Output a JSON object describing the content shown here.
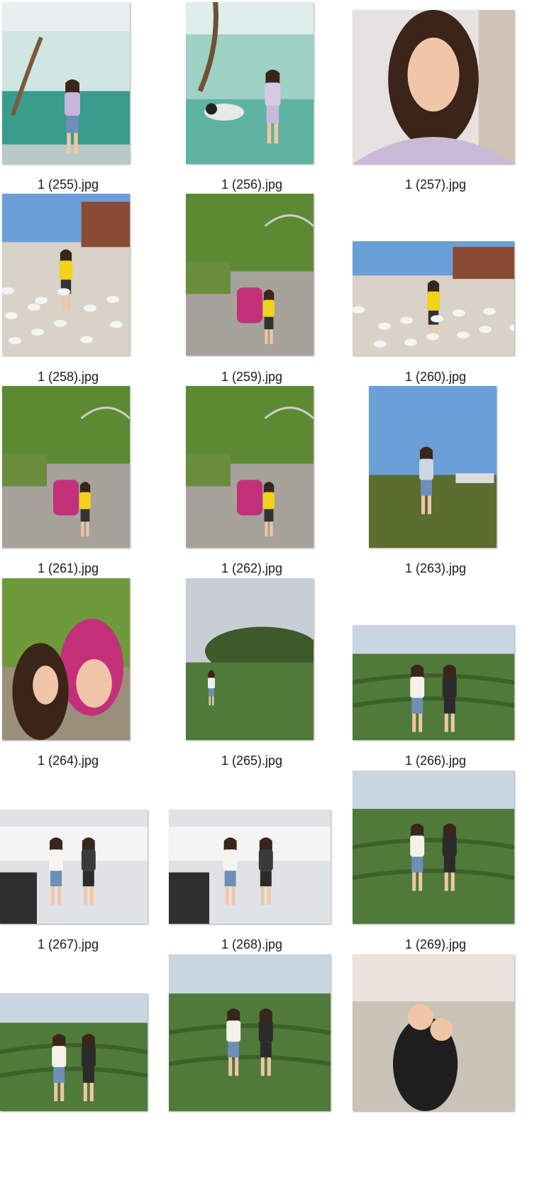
{
  "view": {
    "type": "large-icons",
    "background": "#ffffff"
  },
  "files": [
    {
      "name": "1 (255).jpg",
      "scene": "indoor-pool"
    },
    {
      "name": "1 (256).jpg",
      "scene": "panda-exhibit"
    },
    {
      "name": "1 (257).jpg",
      "scene": "selfie-portrait"
    },
    {
      "name": "1 (258).jpg",
      "scene": "pigeon-square"
    },
    {
      "name": "1 (259).jpg",
      "scene": "tree-path-stroller"
    },
    {
      "name": "1 (260).jpg",
      "scene": "pigeon-square"
    },
    {
      "name": "1 (261).jpg",
      "scene": "tree-path-stroller"
    },
    {
      "name": "1 (262).jpg",
      "scene": "tree-path-stroller"
    },
    {
      "name": "1 (263).jpg",
      "scene": "sunset-field"
    },
    {
      "name": "1 (264).jpg",
      "scene": "stroller-closeup"
    },
    {
      "name": "1 (265).jpg",
      "scene": "tea-field-portrait"
    },
    {
      "name": "1 (266).jpg",
      "scene": "tea-field-landscape"
    },
    {
      "name": "1 (267).jpg",
      "scene": "terrace-duo"
    },
    {
      "name": "1 (268).jpg",
      "scene": "terrace-duo"
    },
    {
      "name": "1 (269).jpg",
      "scene": "tea-field-landscape"
    },
    {
      "name": "",
      "scene": "tea-field-landscape"
    },
    {
      "name": "",
      "scene": "tea-field-landscape"
    },
    {
      "name": "",
      "scene": "living-room"
    }
  ],
  "palette": {
    "label": "#1a1a1a",
    "pool": "#3a9c8c",
    "panda": "#e8e8e8",
    "skin": "#f0c6a8",
    "hair": "#3b2418",
    "yellow": "#f2d21b",
    "pink": "#c2307a",
    "sky": "#6b9fd8",
    "tea": "#4f7a3a",
    "foliage": "#5c8a32"
  }
}
